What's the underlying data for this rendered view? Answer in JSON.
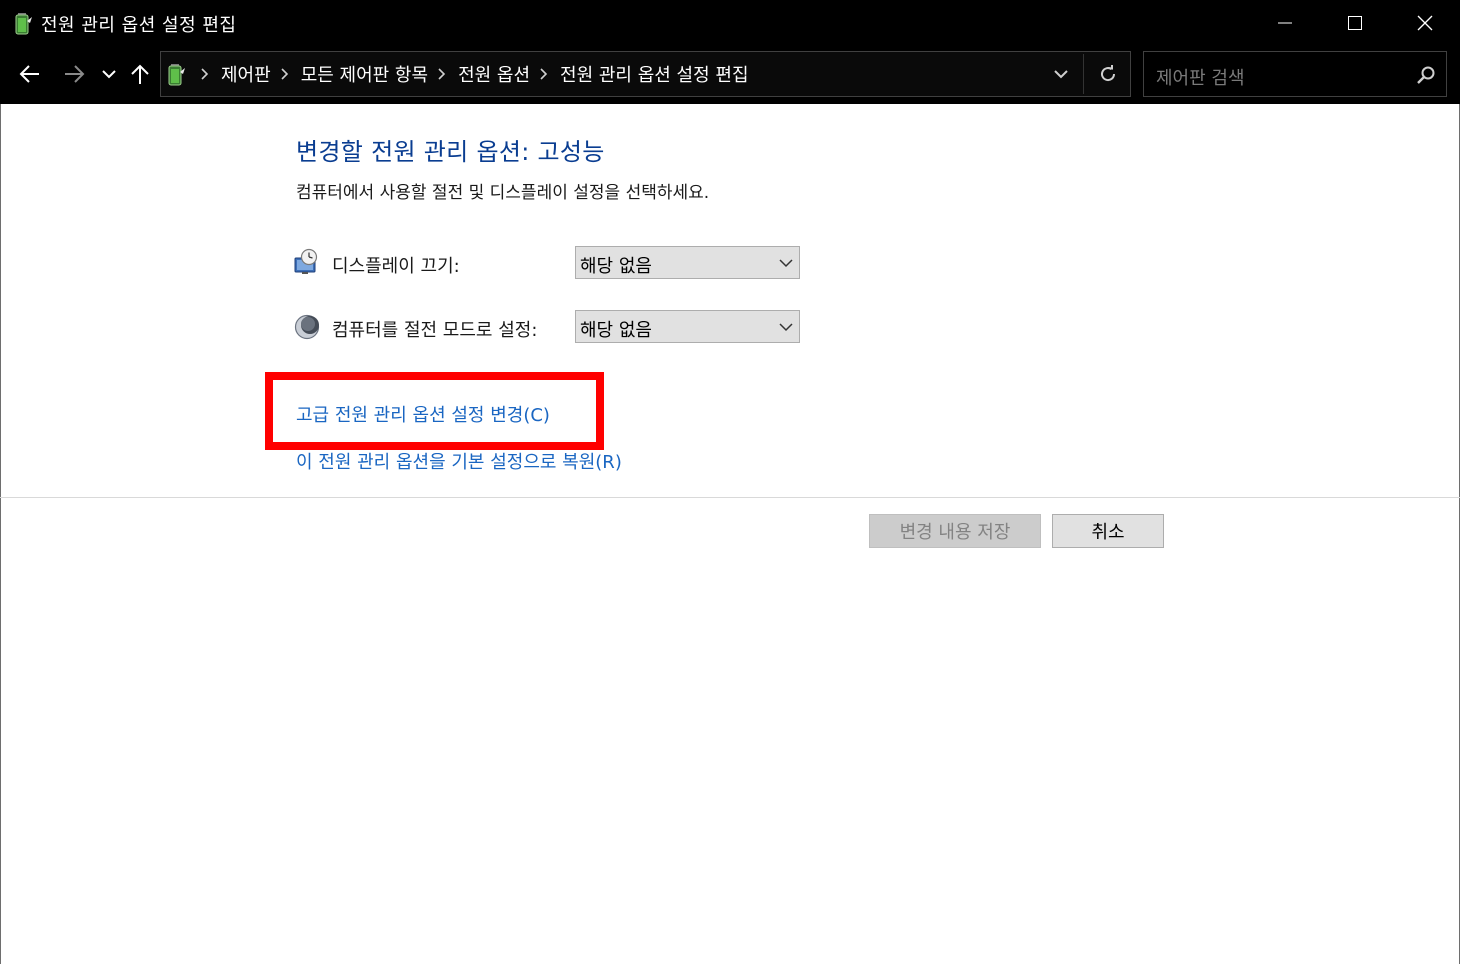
{
  "window": {
    "title": "전원 관리 옵션 설정 편집",
    "minimize_icon": "minimize-icon",
    "maximize_icon": "maximize-icon",
    "close_icon": "close-icon"
  },
  "nav": {
    "breadcrumbs": [
      "제어판",
      "모든 제어판 항목",
      "전원 옵션",
      "전원 관리 옵션 설정 편집"
    ],
    "search_placeholder": "제어판 검색"
  },
  "content": {
    "heading": "변경할 전원 관리 옵션: 고성능",
    "subtitle": "컴퓨터에서 사용할 절전 및 디스플레이 설정을 선택하세요.",
    "settings": [
      {
        "label": "디스플레이 끄기:",
        "value": "해당 없음",
        "icon": "monitor-clock-icon"
      },
      {
        "label": "컴퓨터를 절전 모드로 설정:",
        "value": "해당 없음",
        "icon": "moon-icon"
      }
    ],
    "link_advanced": "고급 전원 관리 옵션 설정 변경(C)",
    "link_restore": "이 전원 관리 옵션을 기본 설정으로 복원(R)"
  },
  "buttons": {
    "save": "변경 내용 저장",
    "cancel": "취소"
  },
  "colors": {
    "heading": "#0a3d91",
    "link": "#1a66c2",
    "highlight": "#ff0000",
    "titlebar": "#000000"
  }
}
